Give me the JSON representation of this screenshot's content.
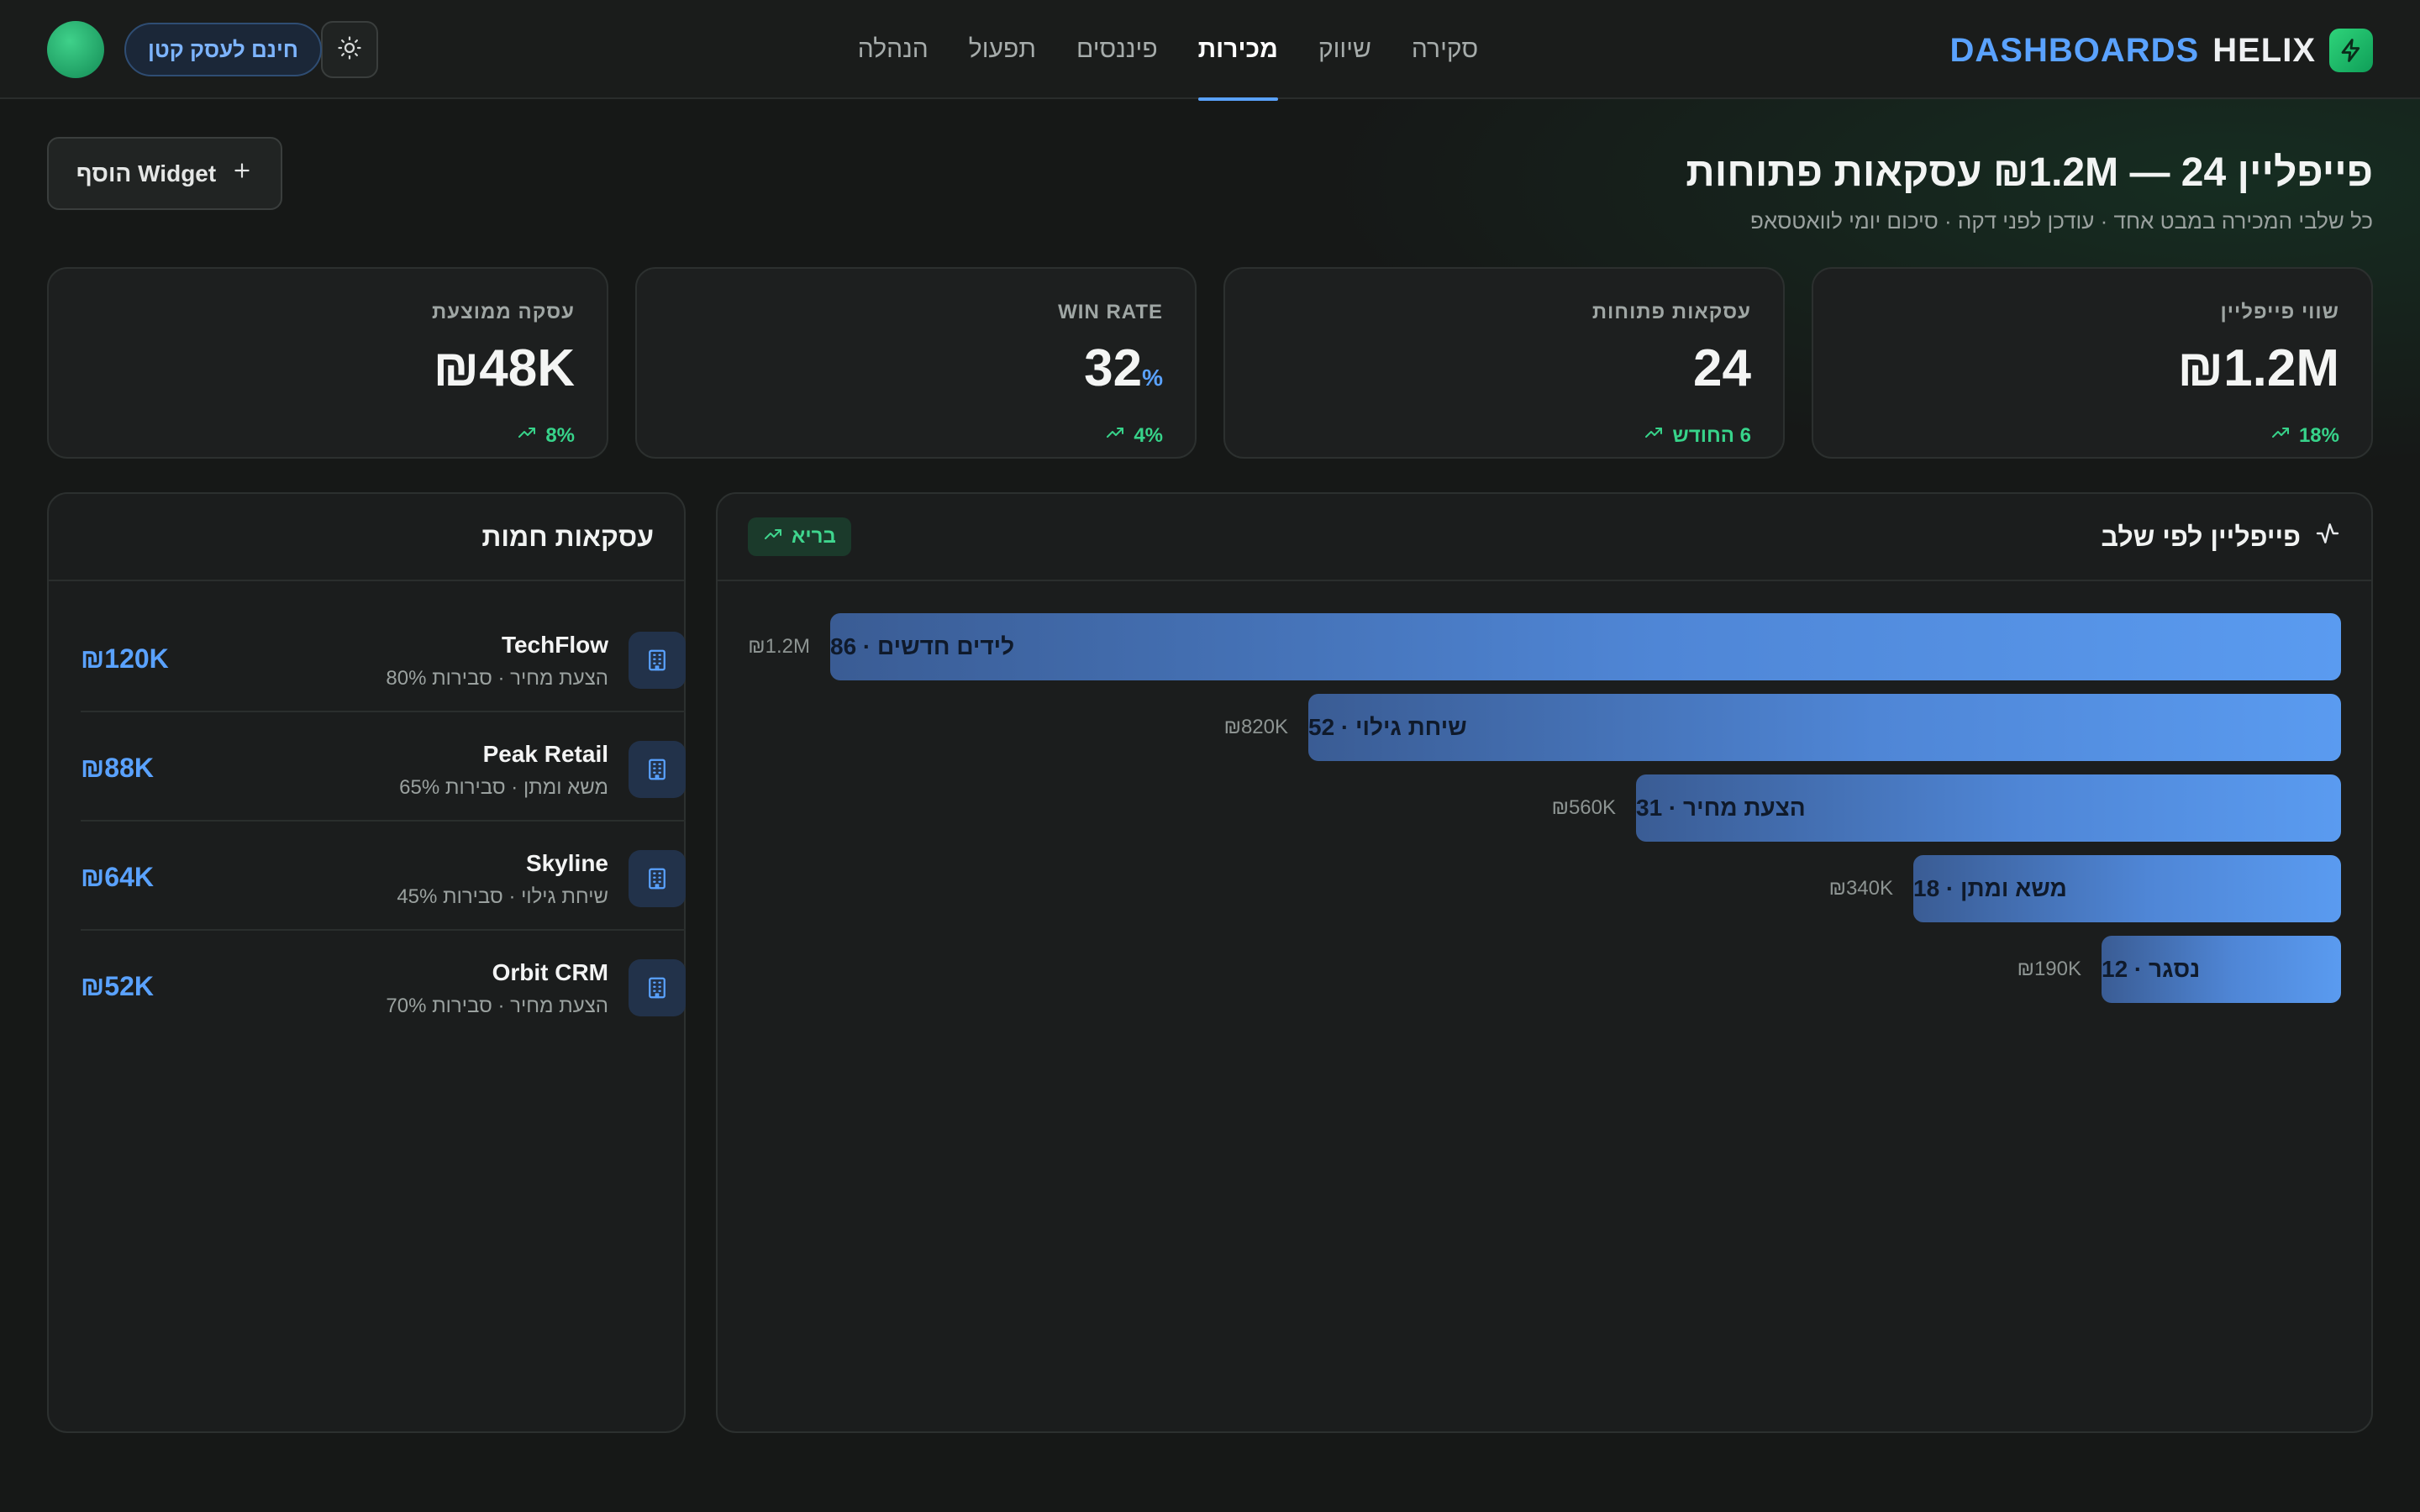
{
  "brand": {
    "word_main": "HELIX",
    "word_accent": "DASHBOARDS",
    "icon": "bolt-icon"
  },
  "nav": {
    "items": [
      {
        "label": "סקירה",
        "active": false
      },
      {
        "label": "שיווק",
        "active": false
      },
      {
        "label": "מכירות",
        "active": true
      },
      {
        "label": "פיננסים",
        "active": false
      },
      {
        "label": "תפעול",
        "active": false
      },
      {
        "label": "הנהלה",
        "active": false
      }
    ]
  },
  "topbar": {
    "promo": "חינם לעסק קטן",
    "theme_icon": "sun-icon"
  },
  "header": {
    "title": "פייפליין 24 — ₪1.2M עסקאות פתוחות",
    "subtitle": "כל שלבי המכירה במבט אחד · עודכן לפני דקה · סיכום יומי לוואטסאפ",
    "add_widget": "הוסף Widget"
  },
  "kpis": [
    {
      "label": "שווי פייפליין",
      "value": "₪1.2M",
      "unit": "",
      "trend": "18%"
    },
    {
      "label": "עסקאות פתוחות",
      "value": "24",
      "unit": "",
      "trend": "6 החודש"
    },
    {
      "label": "WIN RATE",
      "value": "32",
      "unit": "%",
      "trend": "4%"
    },
    {
      "label": "עסקה ממוצעת",
      "value": "₪48K",
      "unit": "",
      "trend": "8%"
    }
  ],
  "pipeline": {
    "title": "פייפליין לפי שלב",
    "badge": "בריא",
    "max_value": 1200,
    "stages": [
      {
        "label": "לידים חדשים · 86",
        "amount": "₪1.2M",
        "value": 1200
      },
      {
        "label": "שיחת גילוי · 52",
        "amount": "₪820K",
        "value": 820
      },
      {
        "label": "הצעת מחיר · 31",
        "amount": "₪560K",
        "value": 560
      },
      {
        "label": "משא ומתן · 18",
        "amount": "₪340K",
        "value": 340
      },
      {
        "label": "נסגר · 12",
        "amount": "₪190K",
        "value": 190
      }
    ]
  },
  "hot_deals": {
    "title": "עסקאות חמות",
    "items": [
      {
        "name": "TechFlow",
        "meta": "הצעת מחיר · סבירות 80%",
        "value": "₪120K"
      },
      {
        "name": "Peak Retail",
        "meta": "משא ומתן · סבירות 65%",
        "value": "₪88K"
      },
      {
        "name": "Skyline",
        "meta": "שיחת גילוי · סבירות 45%",
        "value": "₪64K"
      },
      {
        "name": "Orbit CRM",
        "meta": "הצעת מחיר · סבירות 70%",
        "value": "₪52K"
      }
    ]
  },
  "colors": {
    "accent": "#5aa2ff",
    "positive": "#37d38a",
    "brand_green": "#2ed47a",
    "background": "#161817"
  }
}
